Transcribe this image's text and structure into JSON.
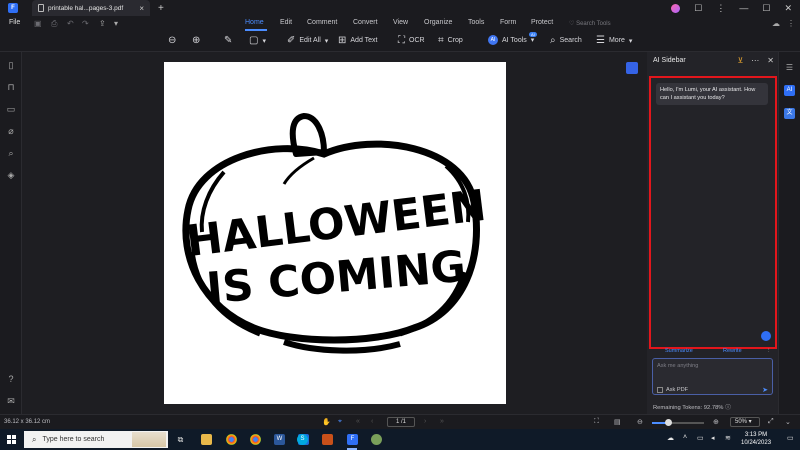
{
  "titlebar": {
    "tab_title": "printable hal...pages-3.pdf",
    "close_tab": "×",
    "new_tab": "+",
    "minimize": "—",
    "maximize": "☐",
    "close": "✕"
  },
  "menubar": {
    "file": "File",
    "items": [
      "Home",
      "Edit",
      "Comment",
      "Convert",
      "View",
      "Organize",
      "Tools",
      "Form",
      "Protect"
    ],
    "active": "Home",
    "search_tools": "Search Tools"
  },
  "toolbar": {
    "edit_all": "Edit All",
    "add_text": "Add Text",
    "ocr": "OCR",
    "crop": "Crop",
    "ai_tools": "AI Tools",
    "ai_badge": "AI",
    "search": "Search",
    "more": "More"
  },
  "ai_sidebar": {
    "title": "AI Sidebar",
    "greeting": "Hello, I'm Lumi, your AI assistant. How can I assistant you today?",
    "chip_summarize": "Summarize",
    "chip_rewrite": "Rewrite",
    "input_placeholder": "Ask me anything",
    "ask_pdf": "Ask PDF",
    "tokens": "Remaining Tokens: 92.78%"
  },
  "document": {
    "line1": "HALLOWEEN",
    "line2": "IS COMING"
  },
  "statusbar": {
    "dimensions": "36.12 x 36.12 cm",
    "page": "1 /1",
    "zoom": "50%",
    "zoom_level": 0.3
  },
  "taskbar": {
    "search_placeholder": "Type here to search",
    "time": "3:13 PM",
    "date": "10/24/2023"
  },
  "colors": {
    "accent": "#4c8dff",
    "highlight_border": "#e2161c"
  }
}
